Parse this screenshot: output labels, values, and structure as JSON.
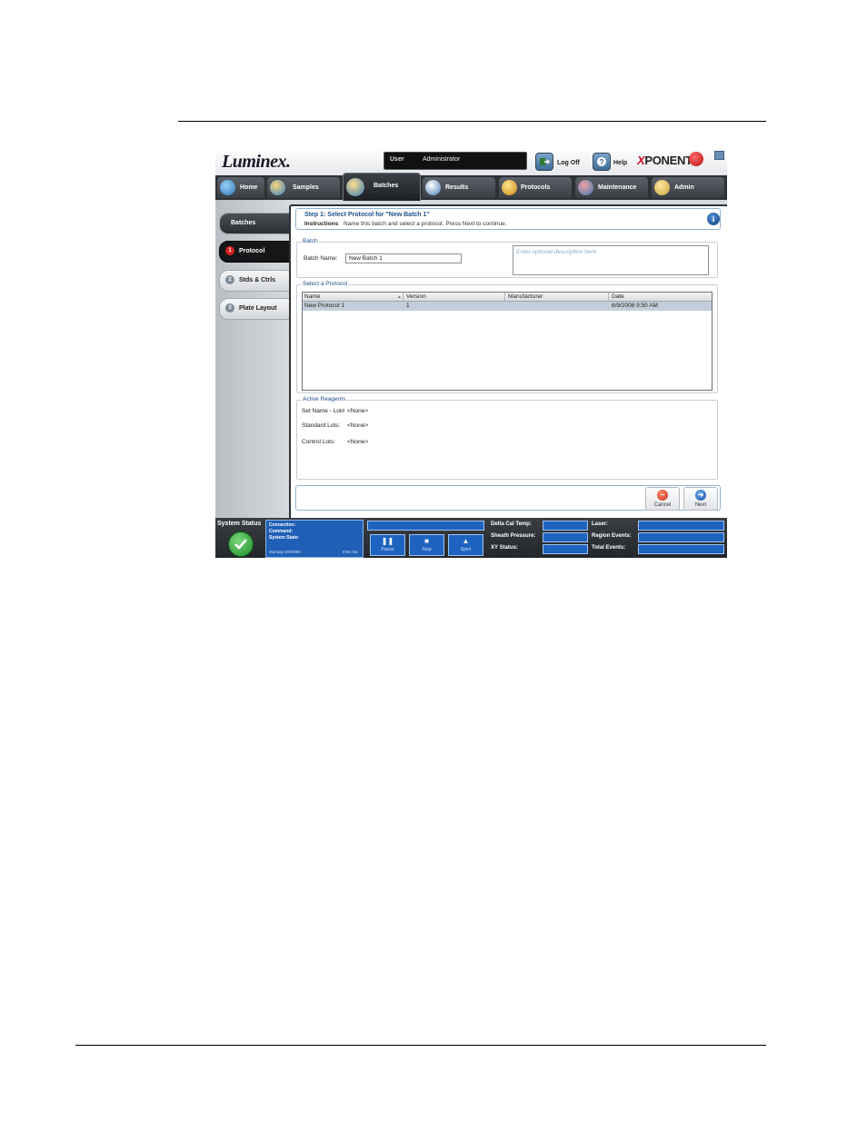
{
  "header": {
    "user_label": "User",
    "user_value": "Administrator",
    "logoff_label": "Log Off",
    "help_label": "Help",
    "brand": "Luminex.",
    "product_x": "X",
    "product_rest": "PONENT"
  },
  "tabs": [
    {
      "label": "Home",
      "icon": "home-icon"
    },
    {
      "label": "Samples",
      "icon": "samples-icon"
    },
    {
      "label": "Batches",
      "icon": "batches-icon",
      "active": true
    },
    {
      "label": "Results",
      "icon": "results-icon"
    },
    {
      "label": "Protocols",
      "icon": "protocols-icon"
    },
    {
      "label": "Maintenance",
      "icon": "maintenance-icon"
    },
    {
      "label": "Admin",
      "icon": "admin-icon"
    }
  ],
  "sidebar": {
    "top": "Batches",
    "items": [
      {
        "num": "1",
        "label": "Protocol",
        "active": true
      },
      {
        "num": "2",
        "label": "Stds & Ctrls"
      },
      {
        "num": "3",
        "label": "Plate Layout"
      }
    ]
  },
  "step": {
    "title": "Step 1: Select Protocol for \"New Batch 1\"",
    "instructions_label": "Instructions",
    "instructions_text": "Name this batch and select a protocol. Press Next to continue.",
    "info_glyph": "i"
  },
  "batch": {
    "group_label": "Batch",
    "name_label": "Batch Name:",
    "name_value": "New Batch 1",
    "description_placeholder": "Enter optional description here"
  },
  "protocol": {
    "group_label": "Select a Protocol",
    "columns": [
      "Name",
      "Version",
      "Manufacturer",
      "Date"
    ],
    "rows": [
      {
        "name": "New Protocol 1",
        "version": "1",
        "manufacturer": "",
        "date": "6/9/2008 9:50 AM"
      }
    ]
  },
  "reagents": {
    "group_label": "Active Reagents",
    "set_name_label": "Set Name - Lot#",
    "set_name_value": "<None>",
    "standard_label": "Standard Lots:",
    "standard_value": "<None>",
    "control_label": "Control Lots:",
    "control_value": "<None>"
  },
  "actions": {
    "cancel": "Cancel",
    "next": "Next"
  },
  "status": {
    "title": "System Status",
    "connection_label": "Connection:",
    "command_label": "Command:",
    "state_label": "System State:",
    "date": "Monday 6/9/2008",
    "time": "9:50 AM",
    "pause": "Pause",
    "stop": "Stop",
    "eject": "Eject",
    "delta_label": "Delta Cal Temp:",
    "sheath_label": "Sheath Pressure:",
    "xy_label": "XY Status:",
    "laser_label": "Laser:",
    "region_label": "Region Events:",
    "total_label": "Total Events:"
  },
  "colors": {
    "accent_blue": "#1f63c0",
    "title_blue": "#1e4f8a",
    "ok_green": "#1c8a2a",
    "active_red": "#d42020"
  }
}
